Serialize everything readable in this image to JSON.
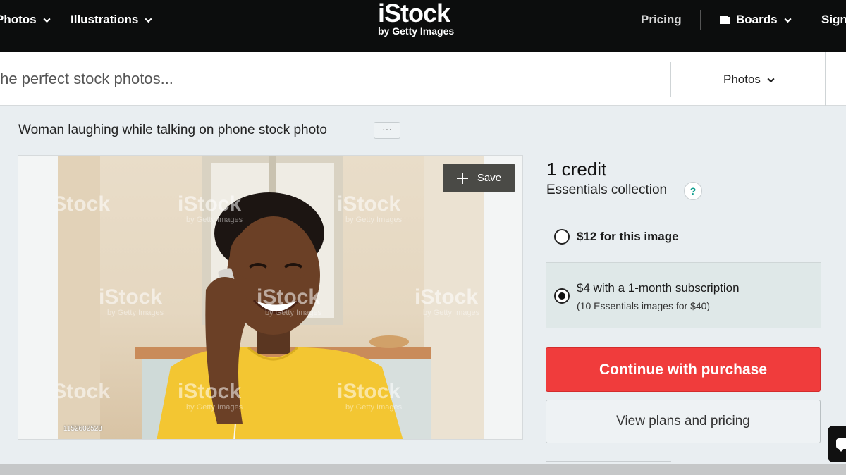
{
  "nav": {
    "photos": "Photos",
    "illustrations": "Illustrations",
    "logo_main": "iStock",
    "logo_sub": "by Getty Images",
    "pricing": "Pricing",
    "boards": "Boards",
    "signin": "Sign"
  },
  "search": {
    "placeholder": "the perfect stock photos...",
    "filter": "Photos"
  },
  "asset": {
    "title": "Woman laughing while talking on phone stock photo",
    "more_label": "···",
    "save_label": "Save",
    "image_id": "1152602523",
    "watermark": "iStock",
    "watermark_sub": "by Getty Images"
  },
  "purchase": {
    "credit": "1 credit",
    "collection": "Essentials collection",
    "help": "?",
    "option1_label": "$12 for this image",
    "option2_label": "$4 with a 1-month subscription",
    "option2_sub": "(10 Essentials images for $40)",
    "continue_label": "Continue with purchase",
    "plans_label": "View plans and pricing",
    "selected_option": 2
  },
  "colors": {
    "nav_bg": "#0c0d0d",
    "cta": "#f03c3c",
    "selected_bg": "#dfe8e8",
    "help_accent": "#0e9d8d"
  }
}
